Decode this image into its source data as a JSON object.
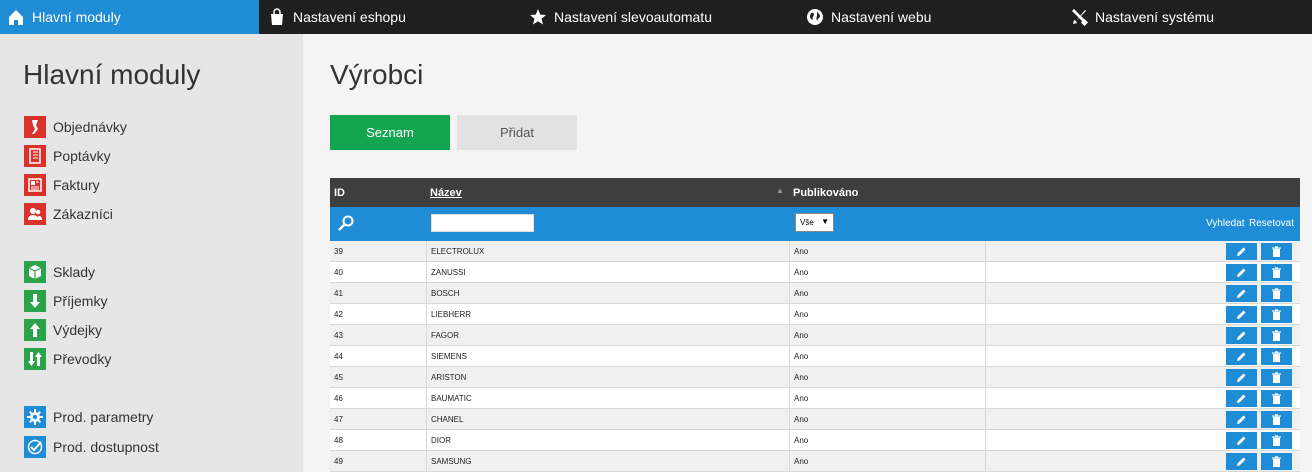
{
  "topnav": [
    {
      "label": "Hlavní moduly",
      "icon": "home-icon"
    },
    {
      "label": "Nastavení eshopu",
      "icon": "shopping-bag-icon"
    },
    {
      "label": "Nastavení slevoautomatu",
      "icon": "star-icon"
    },
    {
      "label": "Nastavení webu",
      "icon": "globe-icon"
    },
    {
      "label": "Nastavení systému",
      "icon": "tools-icon"
    }
  ],
  "sidebar": {
    "title": "Hlavní moduly",
    "items": [
      {
        "label": "Objednávky",
        "icon": "orders-icon",
        "color": "#d9322b"
      },
      {
        "label": "Poptávky",
        "icon": "notebook-icon",
        "color": "#d9322b"
      },
      {
        "label": "Faktury",
        "icon": "invoice-icon",
        "color": "#d9322b"
      },
      {
        "label": "Zákazníci",
        "icon": "users-icon",
        "color": "#d9322b"
      },
      {
        "label": "Sklady",
        "icon": "warehouse-icon",
        "color": "#2aa34a"
      },
      {
        "label": "Příjemky",
        "icon": "arrow-down-icon",
        "color": "#2aa34a"
      },
      {
        "label": "Výdejky",
        "icon": "arrow-up-icon",
        "color": "#2aa34a"
      },
      {
        "label": "Převodky",
        "icon": "transfer-icon",
        "color": "#2aa34a"
      },
      {
        "label": "Prod. parametry",
        "icon": "gear-icon",
        "color": "#1f8dd6"
      },
      {
        "label": "Prod. dostupnost",
        "icon": "check-icon",
        "color": "#1f8dd6"
      }
    ]
  },
  "main": {
    "title": "Výrobci",
    "tab_list": "Seznam",
    "tab_add": "Přidat"
  },
  "grid": {
    "col_id": "ID",
    "col_name": "Název",
    "col_published": "Publikováno",
    "filter_select": "Vše",
    "search_label": "Vyhledat",
    "reset_label": "Resetovat",
    "rows": [
      {
        "id": "39",
        "name": "ELECTROLUX",
        "published": "Ano"
      },
      {
        "id": "40",
        "name": "ZANUSSI",
        "published": "Ano"
      },
      {
        "id": "41",
        "name": "BOSCH",
        "published": "Ano"
      },
      {
        "id": "42",
        "name": "LIEBHERR",
        "published": "Ano"
      },
      {
        "id": "43",
        "name": "FAGOR",
        "published": "Ano"
      },
      {
        "id": "44",
        "name": "SIEMENS",
        "published": "Ano"
      },
      {
        "id": "45",
        "name": "ARISTON",
        "published": "Ano"
      },
      {
        "id": "46",
        "name": "BAUMATIC",
        "published": "Ano"
      },
      {
        "id": "47",
        "name": "CHANEL",
        "published": "Ano"
      },
      {
        "id": "48",
        "name": "DIOR",
        "published": "Ano"
      },
      {
        "id": "49",
        "name": "SAMSUNG",
        "published": "Ano"
      }
    ]
  },
  "colors": {
    "accent": "#1f8dd6",
    "success": "#14a550",
    "danger": "#d9322b",
    "header": "#3e3e3e"
  }
}
